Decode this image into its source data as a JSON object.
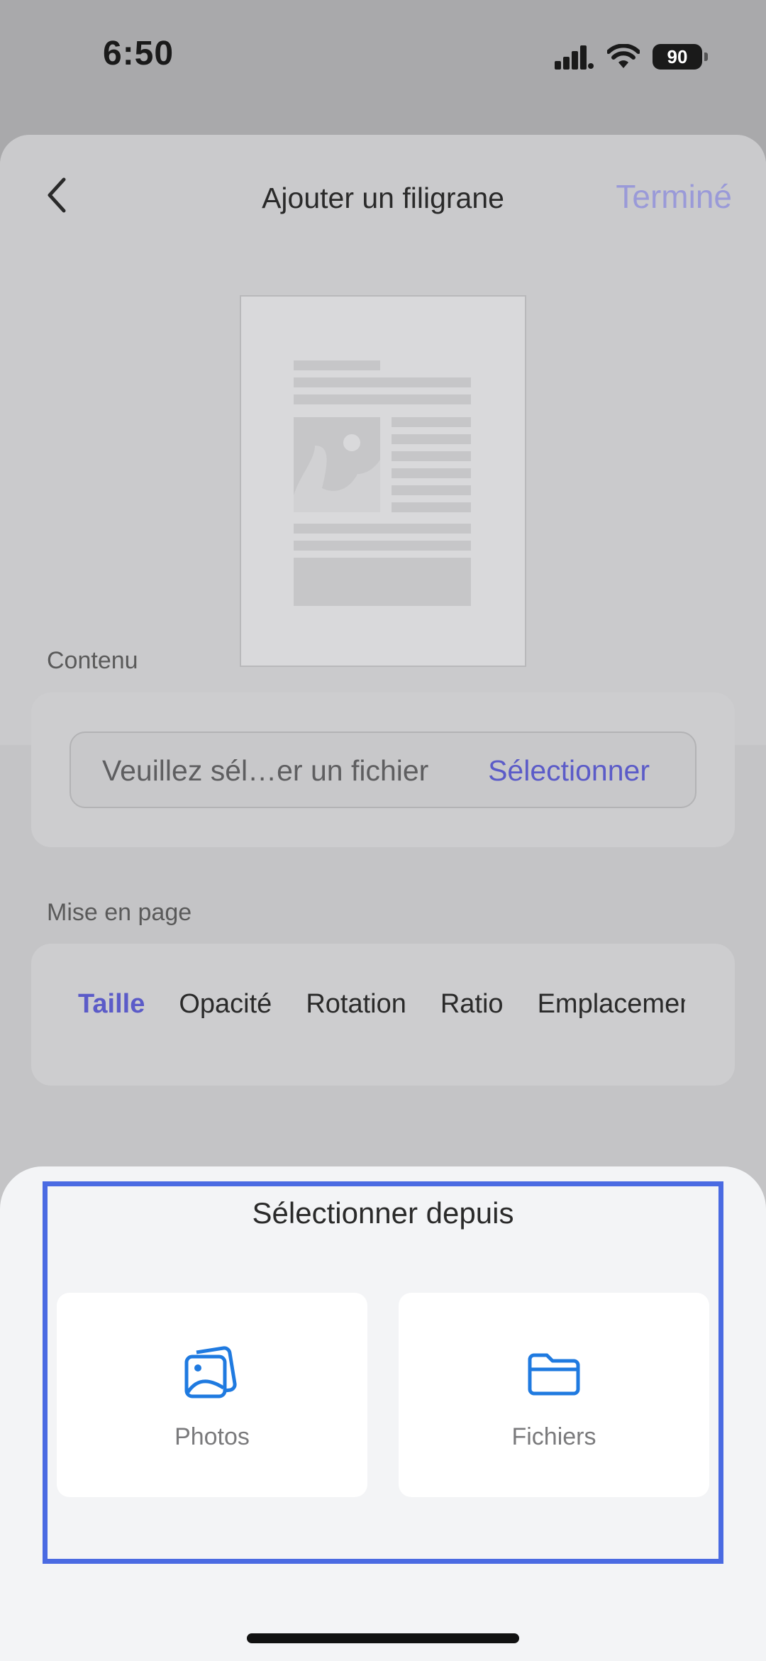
{
  "status_bar": {
    "time": "6:50",
    "battery": "90"
  },
  "header": {
    "title": "Ajouter un filigrane",
    "done_label": "Terminé"
  },
  "content": {
    "section_label": "Contenu",
    "file_placeholder": "Veuillez sél…er un fichier",
    "select_label": "Sélectionner"
  },
  "layout": {
    "section_label": "Mise en page",
    "tabs": [
      {
        "label": "Taille",
        "active": true
      },
      {
        "label": "Opacité",
        "active": false
      },
      {
        "label": "Rotation",
        "active": false
      },
      {
        "label": "Ratio",
        "active": false
      },
      {
        "label": "Emplacement",
        "active": false
      }
    ]
  },
  "action_sheet": {
    "title": "Sélectionner depuis",
    "options": [
      {
        "label": "Photos",
        "icon": "photos-icon"
      },
      {
        "label": "Fichiers",
        "icon": "folder-icon"
      }
    ]
  },
  "colors": {
    "accent": "#5b5bc8",
    "icon_blue": "#1f7ae0",
    "highlight": "#4a6ae2"
  }
}
